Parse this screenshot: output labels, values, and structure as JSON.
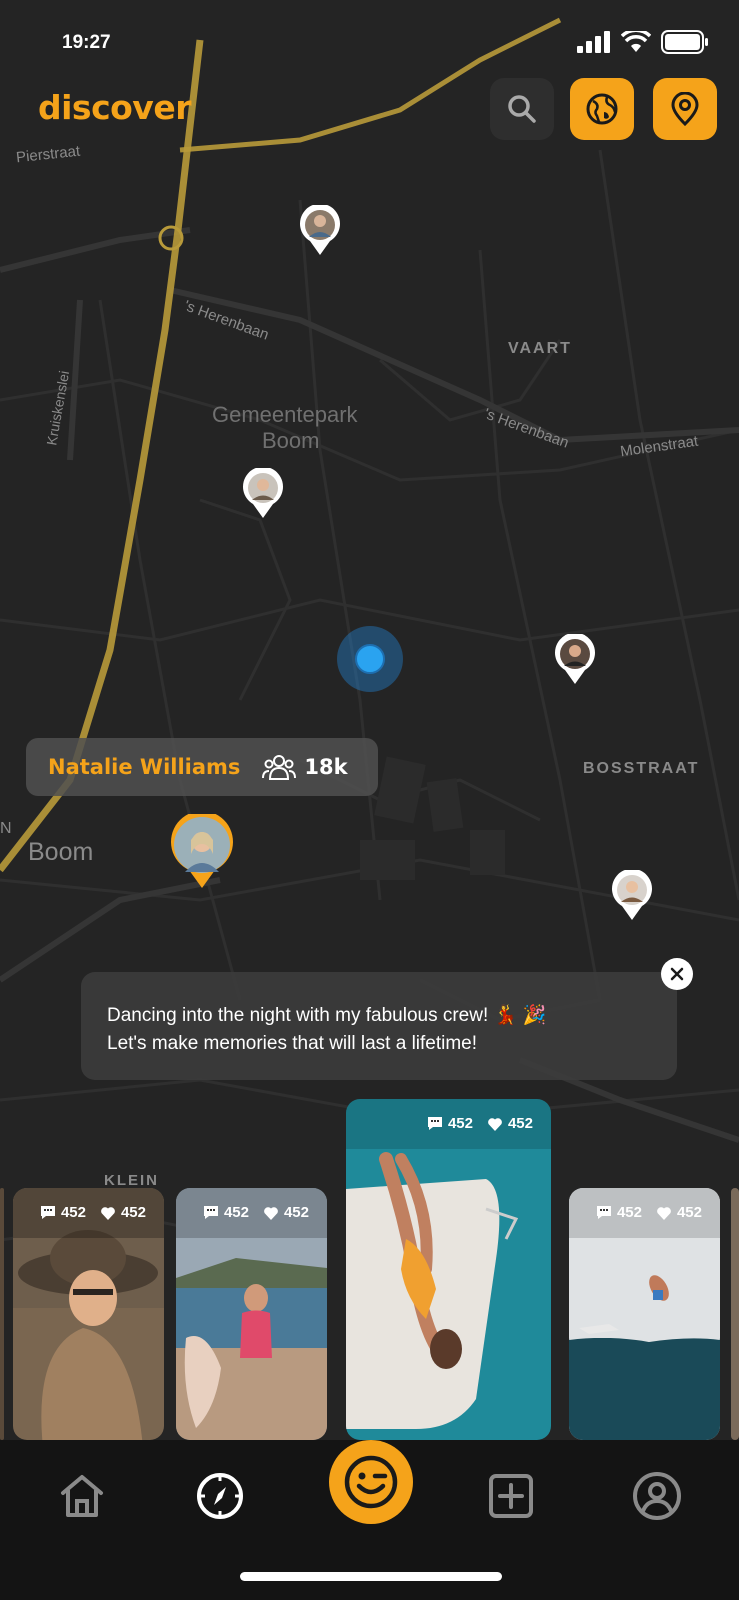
{
  "status": {
    "time": "19:27"
  },
  "header": {
    "title": "discover"
  },
  "map": {
    "labels": {
      "pierstraat": "Pierstraat",
      "herenbaan1": "'s Herenbaan",
      "vaart": "VAART",
      "kruiskenslei": "Kruiskenslei",
      "park": "Gemeentepark",
      "park2": "Boom",
      "herenbaan2": "'s Herenbaan",
      "molenstraat": "Molenstraat",
      "bosstraat": "BOSSTRAAT",
      "boom": "Boom",
      "klein": "KLEIN",
      "n": "N"
    }
  },
  "profile_card": {
    "name": "Natalie Williams",
    "followers": "18k"
  },
  "caption": {
    "line1": "Dancing into the night with my fabulous crew! 💃 🎉",
    "line2": "Let's make memories that will last a lifetime!"
  },
  "posts": [
    {
      "comments": "452",
      "likes": "452"
    },
    {
      "comments": "452",
      "likes": "452"
    },
    {
      "comments": "452",
      "likes": "452"
    },
    {
      "comments": "452",
      "likes": "452"
    }
  ],
  "colors": {
    "accent": "#f5a31a",
    "map_bg": "#222222",
    "location": "#2aa3f0"
  },
  "icons": [
    "search-icon",
    "globe-icon",
    "map-pin-icon",
    "home-icon",
    "compass-icon",
    "wink-face-icon",
    "plus-square-icon",
    "profile-icon",
    "comment-icon",
    "heart-icon",
    "followers-icon",
    "close-icon"
  ]
}
